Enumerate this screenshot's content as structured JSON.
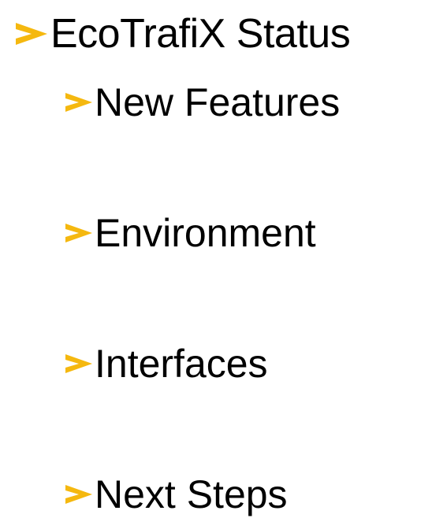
{
  "slide": {
    "title": "EcoTrafiX Status",
    "bullets": [
      "New Features",
      "Environment",
      "Interfaces",
      "Next Steps"
    ]
  },
  "icons": {
    "bullet_marker": "chevron-right-icon"
  },
  "colors": {
    "accent": "#F5B80F",
    "text": "#000000",
    "background": "#FFFFFF"
  }
}
